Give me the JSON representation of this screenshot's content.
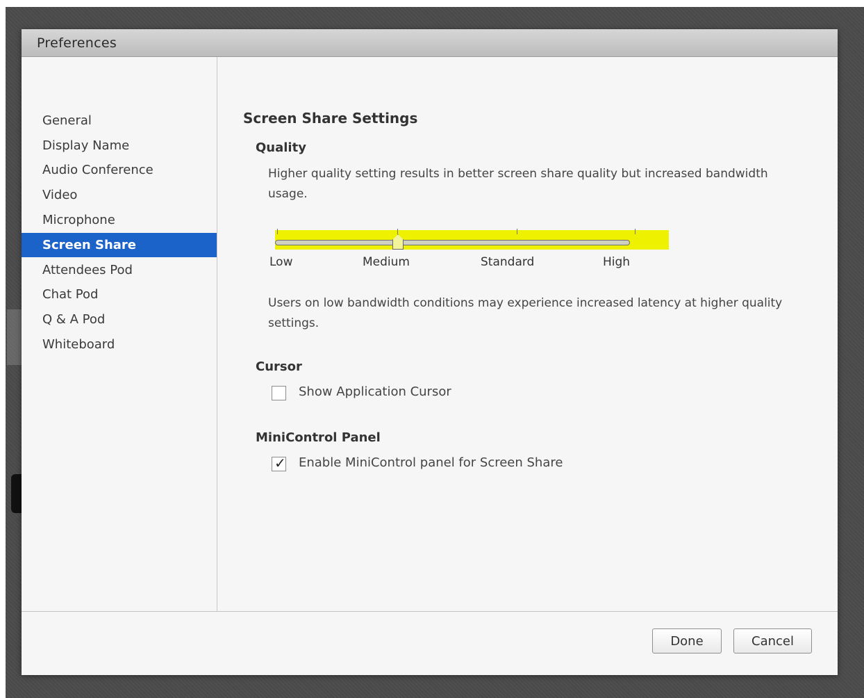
{
  "dialog": {
    "title": "Preferences"
  },
  "sidebar": {
    "items": [
      {
        "label": "General"
      },
      {
        "label": "Display Name"
      },
      {
        "label": "Audio Conference"
      },
      {
        "label": "Video"
      },
      {
        "label": "Microphone"
      },
      {
        "label": "Screen Share",
        "selected": true
      },
      {
        "label": "Attendees Pod"
      },
      {
        "label": "Chat Pod"
      },
      {
        "label": "Q & A Pod"
      },
      {
        "label": "Whiteboard"
      }
    ]
  },
  "main": {
    "title": "Screen Share Settings",
    "quality": {
      "heading": "Quality",
      "description": "Higher quality setting results in better screen share quality but increased bandwidth usage.",
      "slider": {
        "labels": [
          "Low",
          "Medium",
          "Standard",
          "High"
        ],
        "value": "Medium",
        "highlight_color": "#eef200"
      },
      "note": "Users on low bandwidth conditions may experience increased latency at higher quality settings."
    },
    "cursor": {
      "heading": "Cursor",
      "checkbox_label": "Show Application Cursor",
      "checked": false
    },
    "minicontrol": {
      "heading": "MiniControl Panel",
      "checkbox_label": "Enable MiniControl panel for Screen Share",
      "checked": true
    }
  },
  "footer": {
    "done_label": "Done",
    "cancel_label": "Cancel"
  },
  "colors": {
    "selection": "#1b63c9",
    "highlight": "#eef200"
  }
}
